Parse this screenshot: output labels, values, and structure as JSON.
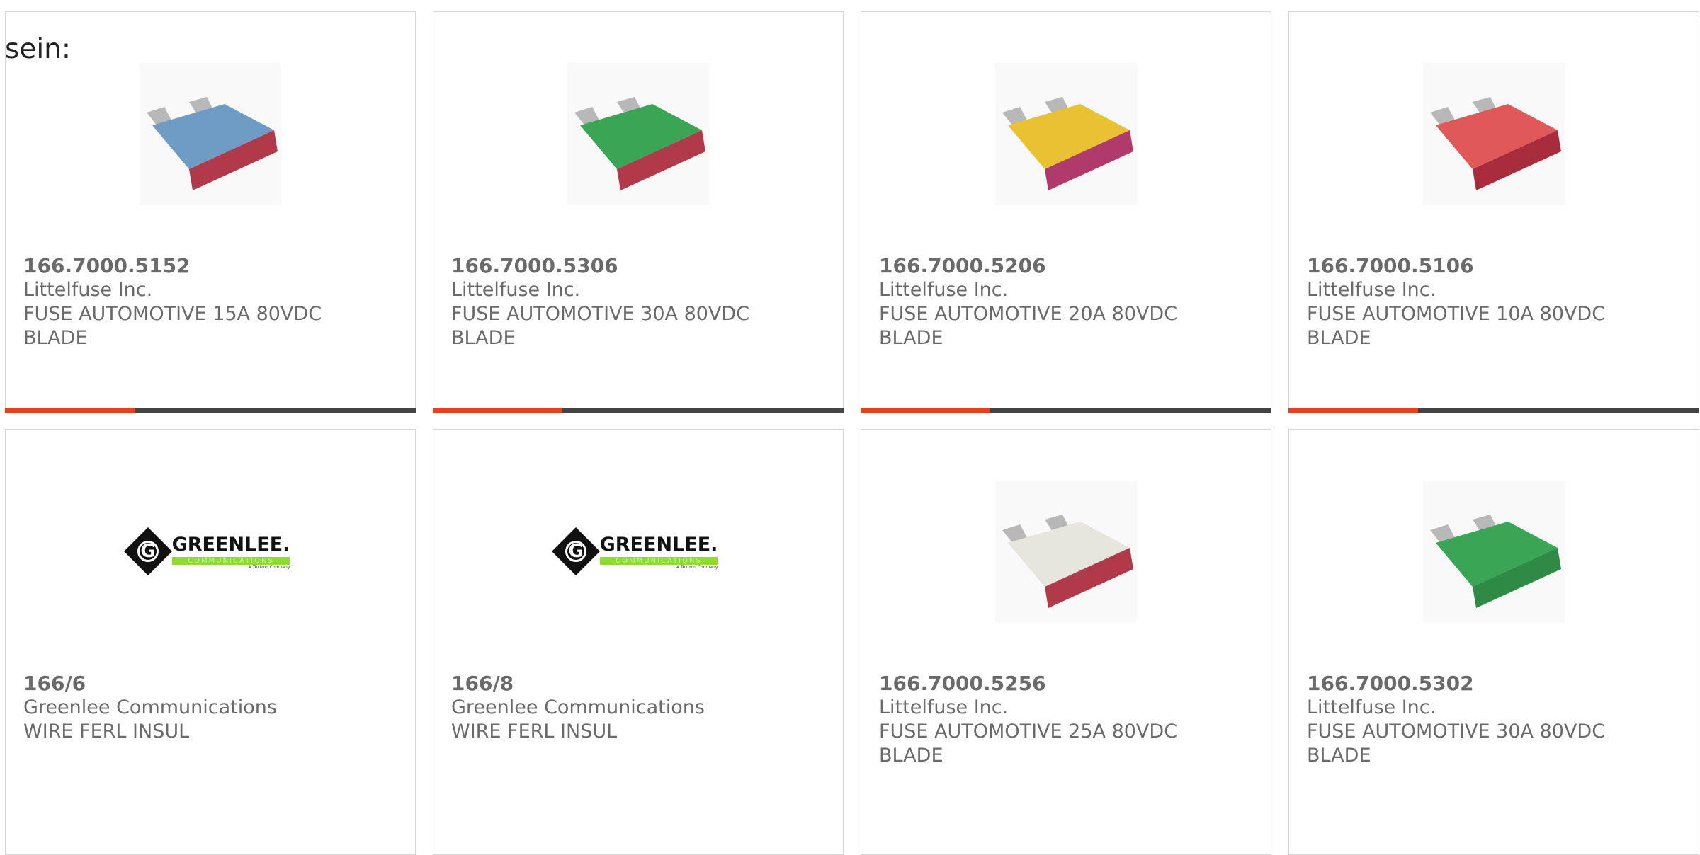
{
  "intro_text": "sein:",
  "colors": {
    "accent": "#e8401c",
    "bar": "#444444",
    "border": "#d6d6d6",
    "text": "#6a6a6a"
  },
  "products": [
    {
      "part_number": "166.7000.5152",
      "manufacturer": "Littelfuse Inc.",
      "description": "FUSE AUTOMOTIVE 15A 80VDC BLADE",
      "image": "blade-fuse-blue",
      "fuse_color": "#6f9cc4"
    },
    {
      "part_number": "166.7000.5306",
      "manufacturer": "Littelfuse Inc.",
      "description": "FUSE AUTOMOTIVE 30A 80VDC BLADE",
      "image": "blade-fuse-green",
      "fuse_color": "#3aa655"
    },
    {
      "part_number": "166.7000.5206",
      "manufacturer": "Littelfuse Inc.",
      "description": "FUSE AUTOMOTIVE 20A 80VDC BLADE",
      "image": "blade-fuse-yellow",
      "fuse_color": "#e8c232"
    },
    {
      "part_number": "166.7000.5106",
      "manufacturer": "Littelfuse Inc.",
      "description": "FUSE AUTOMOTIVE 10A 80VDC BLADE",
      "image": "blade-fuse-red",
      "fuse_color": "#e05858"
    },
    {
      "part_number": "166/6",
      "manufacturer": "Greenlee Communications",
      "description": "WIRE FERL INSUL",
      "image": "greenlee-logo",
      "logo": {
        "brand": "GREENLEE.",
        "sub": "COMMUNICATIONS",
        "tag": "A Textron Company"
      }
    },
    {
      "part_number": "166/8",
      "manufacturer": "Greenlee Communications",
      "description": "WIRE FERL INSUL",
      "image": "greenlee-logo",
      "logo": {
        "brand": "GREENLEE.",
        "sub": "COMMUNICATIONS",
        "tag": "A Textron Company"
      }
    },
    {
      "part_number": "166.7000.5256",
      "manufacturer": "Littelfuse Inc.",
      "description": "FUSE AUTOMOTIVE 25A 80VDC BLADE",
      "image": "blade-fuse-white",
      "fuse_color": "#e6e6dc"
    },
    {
      "part_number": "166.7000.5302",
      "manufacturer": "Littelfuse Inc.",
      "description": "FUSE AUTOMOTIVE 30A 80VDC BLADE",
      "image": "blade-fuse-green",
      "fuse_color": "#3aa655"
    }
  ]
}
